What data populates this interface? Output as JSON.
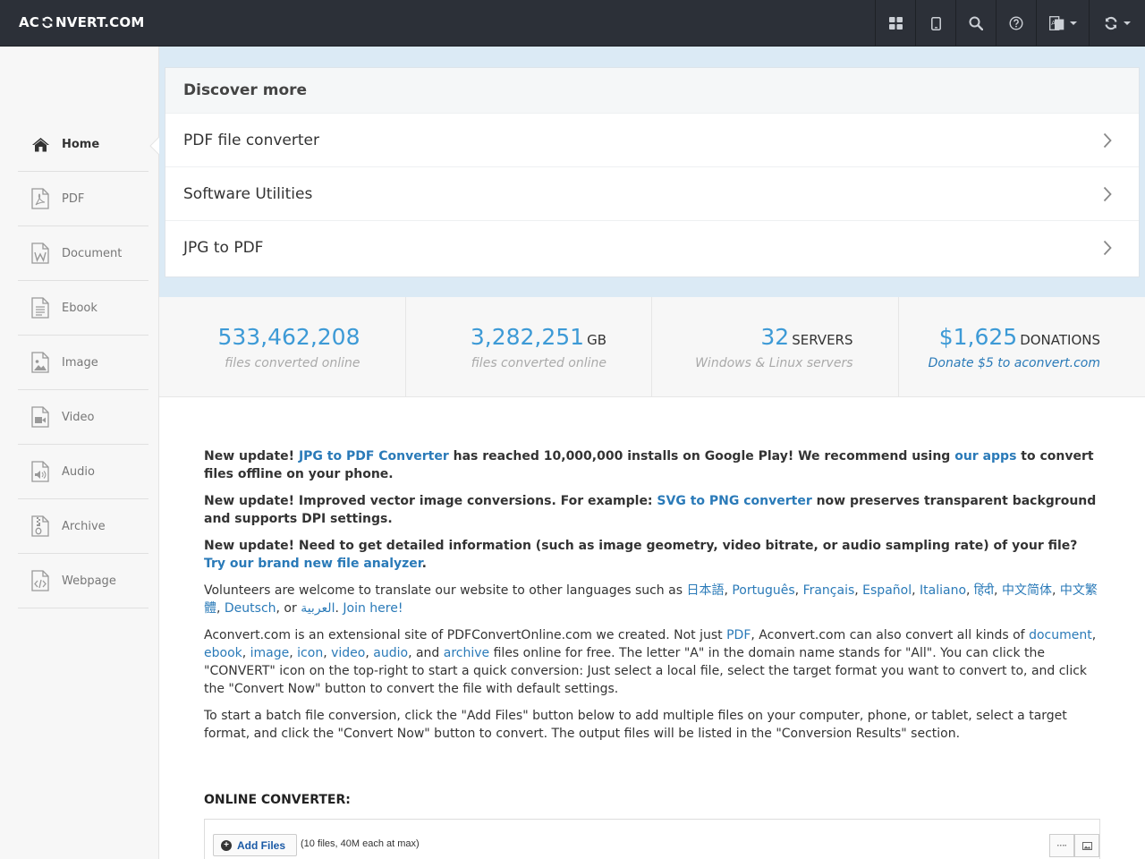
{
  "header": {
    "logo_left": "AC",
    "logo_right": "NVERT.COM",
    "icons": [
      "grid-icon",
      "tablet-icon",
      "search-icon",
      "help-icon",
      "language-icon",
      "convert-icon"
    ]
  },
  "sidebar": {
    "items": [
      {
        "label": "Home",
        "icon": "home-icon",
        "active": true
      },
      {
        "label": "PDF",
        "icon": "pdf-icon"
      },
      {
        "label": "Document",
        "icon": "document-icon"
      },
      {
        "label": "Ebook",
        "icon": "ebook-icon"
      },
      {
        "label": "Image",
        "icon": "image-icon"
      },
      {
        "label": "Video",
        "icon": "video-icon"
      },
      {
        "label": "Audio",
        "icon": "audio-icon"
      },
      {
        "label": "Archive",
        "icon": "archive-icon"
      },
      {
        "label": "Webpage",
        "icon": "webpage-icon"
      }
    ]
  },
  "discover": {
    "title": "Discover more",
    "items": [
      "PDF file converter",
      "Software Utilities",
      "JPG to PDF"
    ]
  },
  "stats": [
    {
      "value": "533,462,208",
      "unit": "",
      "sub": "files converted online"
    },
    {
      "value": "3,282,251",
      "unit": "GB",
      "sub": "files converted online"
    },
    {
      "value": "32",
      "unit": "SERVERS",
      "sub": "Windows & Linux servers"
    },
    {
      "value": "$1,625",
      "unit": "DONATIONS",
      "sub": "Donate $5 to aconvert.com"
    }
  ],
  "updates": {
    "u1_a": "New update! ",
    "u1_link": "JPG to PDF Converter",
    "u1_b": " has reached 10,000,000 installs on Google Play! We recommend using ",
    "u1_link2": "our apps",
    "u1_c": " to convert files offline on your phone.",
    "u2_a": "New update! Improved vector image conversions. For example: ",
    "u2_link": "SVG to PNG converter",
    "u2_b": " now preserves transparent background and supports DPI settings.",
    "u3_a": "New update! Need to get detailed information (such as image geometry, video bitrate, or audio sampling rate) of your file? ",
    "u3_link": "Try our brand new file analyzer",
    "u3_b": "."
  },
  "volunteers": {
    "intro": "Volunteers are welcome to translate our website to other languages such as ",
    "languages": [
      "日本語",
      "Português",
      "Français",
      "Español",
      "Italiano",
      "हिंदी",
      "中文简体",
      "中文繁體",
      "Deutsch",
      "العربية"
    ],
    "or": ", or ",
    "join": "Join here!"
  },
  "about": {
    "a": "Aconvert.com is an extensional site of PDFConvertOnline.com we created. Not just ",
    "pdf": "PDF",
    "b": ", Aconvert.com can also convert all kinds of ",
    "document": "document",
    "ebook": "ebook",
    "image": "image",
    "icon": "icon",
    "video": "video",
    "audio": "audio",
    "and": ", and ",
    "archive": "archive",
    "c": " files online for free. The letter \"A\" in the domain name stands for \"All\". You can click the \"CONVERT\" icon on the top-right to start a quick conversion: Just select a local file, select the target format you want to convert to, and click the \"Convert Now\" button to convert the file with default settings."
  },
  "batch": "To start a batch file conversion, click the \"Add Files\" button below to add multiple files on your computer, phone, or tablet, select a target format, and click the \"Convert Now\" button to convert. The output files will be listed in the \"Conversion Results\" section.",
  "converter": {
    "title": "ONLINE CONVERTER:",
    "add_files": "Add Files",
    "note": "(10 files, 40M each at max)"
  },
  "colors": {
    "topbar": "#2c3038",
    "accent": "#3d9ad6",
    "link": "#2a7ab8",
    "discover_bg": "#dbeaf5"
  }
}
